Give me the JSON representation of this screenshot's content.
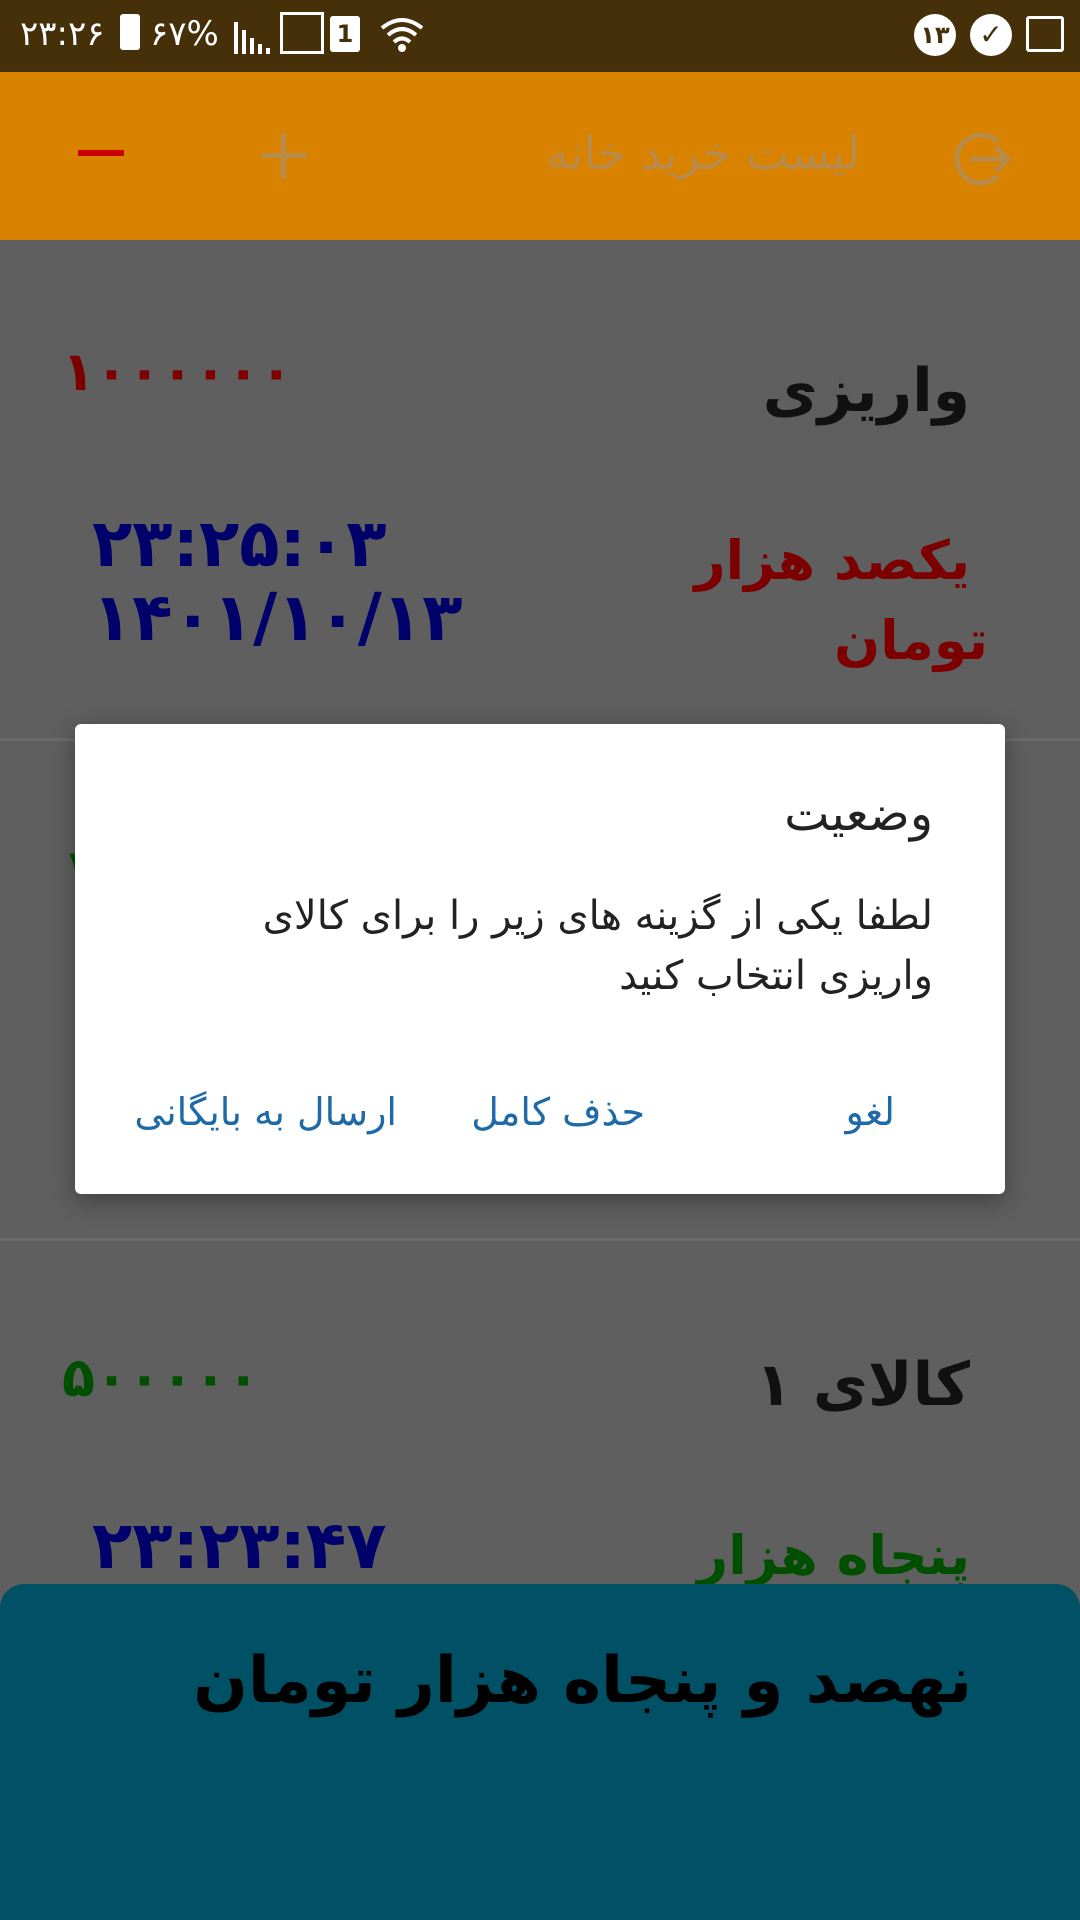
{
  "status_bar": {
    "time": "۲۳:۲۶",
    "battery": "۶۷%",
    "sim": "1",
    "notification_badge": "۱۳"
  },
  "app_bar": {
    "title": "لیست خرید خانه",
    "minus_icon": "minus-icon",
    "plus_icon": "plus-icon",
    "exit_icon": "exit-icon"
  },
  "items": [
    {
      "name": "واریزی",
      "amount": "۱۰۰۰۰۰۰",
      "amount_words_line1": "یکصد هزار",
      "amount_words_line2": "تومان",
      "time": "۲۳:۲۵:۰۳",
      "date": "۱۴۰۱/۱۰/۱۳",
      "amount_color": "#7d0000"
    },
    {
      "name": "کالای ۱",
      "amount": "۵۰۰۰۰۰",
      "amount_words_line1": "پنجاه هزار",
      "time": "۲۳:۲۳:۴۷",
      "amount_color": "#004f00"
    }
  ],
  "dialog": {
    "title": "وضعیت",
    "message": "لطفا یکی از گزینه های زیر را برای کالای واریزی انتخاب کنید",
    "cancel": "لغو",
    "delete": "حذف کامل",
    "archive": "ارسال به بایگانی"
  },
  "total": {
    "text": "نهصد و پنجاه هزار تومان"
  }
}
